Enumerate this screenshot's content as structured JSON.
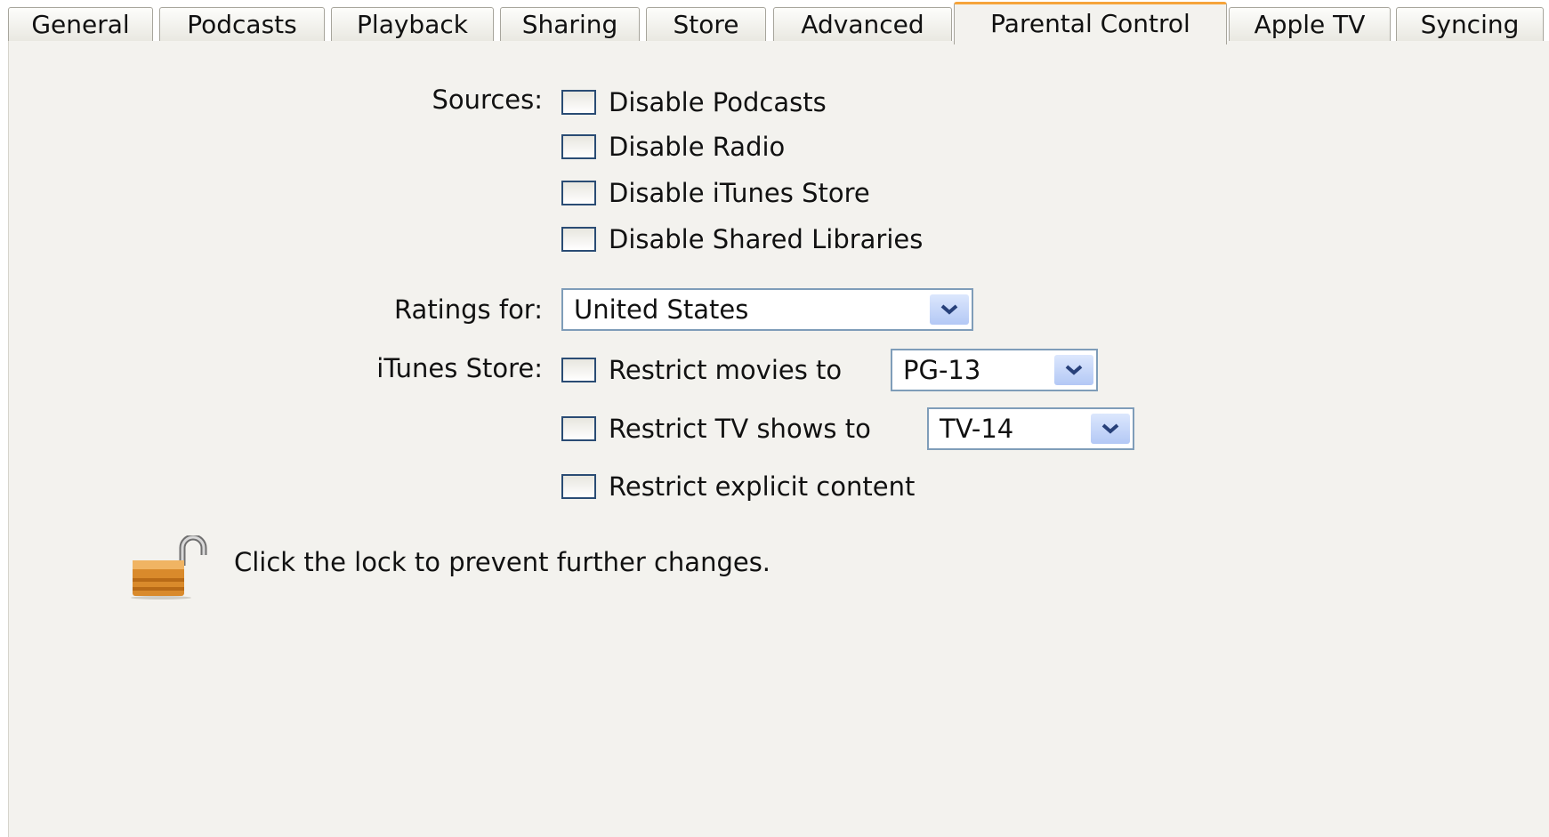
{
  "tabs": [
    {
      "label": "General"
    },
    {
      "label": "Podcasts"
    },
    {
      "label": "Playback"
    },
    {
      "label": "Sharing"
    },
    {
      "label": "Store"
    },
    {
      "label": "Advanced"
    },
    {
      "label": "Parental Control",
      "active": true
    },
    {
      "label": "Apple TV"
    },
    {
      "label": "Syncing"
    }
  ],
  "sources": {
    "label": "Sources:",
    "options": [
      {
        "label": "Disable Podcasts",
        "checked": false
      },
      {
        "label": "Disable Radio",
        "checked": false
      },
      {
        "label": "Disable iTunes Store",
        "checked": false
      },
      {
        "label": "Disable Shared Libraries",
        "checked": false
      }
    ]
  },
  "ratings": {
    "label": "Ratings for:",
    "value": "United States"
  },
  "store": {
    "label": "iTunes Store:",
    "movies": {
      "label": "Restrict movies to",
      "checked": false,
      "value": "PG-13"
    },
    "tv": {
      "label": "Restrict TV shows to",
      "checked": false,
      "value": "TV-14"
    },
    "explicit": {
      "label": "Restrict explicit content",
      "checked": false
    }
  },
  "lock": {
    "icon": "unlocked-padlock-icon",
    "message": "Click the lock to prevent further changes."
  },
  "colors": {
    "active_tab_accent": "#f6a43b",
    "panel_background": "#f3f2ee",
    "checkbox_border": "#2a4c74",
    "select_border": "#7f9db9"
  }
}
